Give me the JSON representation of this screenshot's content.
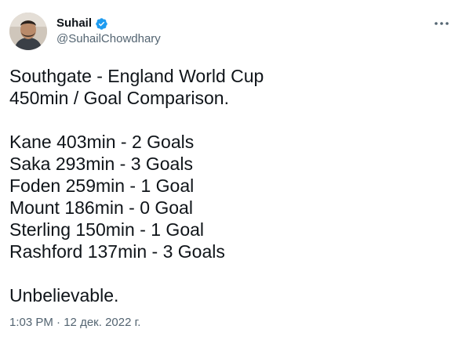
{
  "author": {
    "display_name": "Suhail",
    "handle": "@SuhailChowdhary",
    "verified": true,
    "verified_color": "#1d9bf0"
  },
  "menu": {
    "icon": "more-horizontal-icon"
  },
  "tweet": {
    "header_lines": [
      "Southgate - England World Cup",
      "450min / Goal Comparison."
    ],
    "player_lines": [
      "Kane 403min - 2 Goals",
      "Saka 293min - 3 Goals",
      "Foden 259min - 1 Goal",
      "Mount 186min - 0 Goal",
      "Sterling 150min - 1 Goal",
      "Rashford 137min - 3 Goals"
    ],
    "closing": "Unbelievable."
  },
  "meta": {
    "time": "1:03 PM",
    "separator": "·",
    "date": "12 дек. 2022 г."
  },
  "colors": {
    "text": "#0f1419",
    "secondary": "#536471",
    "background": "#ffffff"
  }
}
